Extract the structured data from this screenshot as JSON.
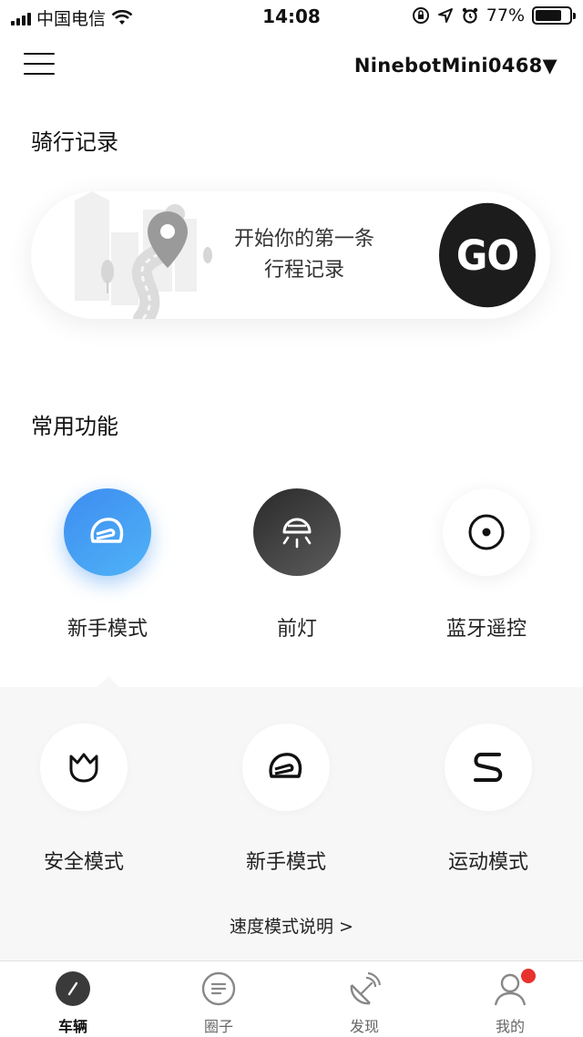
{
  "status_bar": {
    "carrier": "中国电信",
    "time": "14:08",
    "battery_percent": "77%",
    "battery_level": 0.77
  },
  "header": {
    "device_name": "NinebotMini0468▼"
  },
  "ride_record": {
    "title": "骑行记录",
    "prompt_line1": "开始你的第一条",
    "prompt_line2": "行程记录",
    "go_label": "GO"
  },
  "common_functions": {
    "title": "常用功能",
    "items": [
      {
        "label": "新手模式",
        "icon": "helmet-icon",
        "style": "blue"
      },
      {
        "label": "前灯",
        "icon": "headlight-icon",
        "style": "dark"
      },
      {
        "label": "蓝牙遥控",
        "icon": "remote-target-icon",
        "style": "light"
      }
    ]
  },
  "speed_modes": {
    "items": [
      {
        "label": "安全模式",
        "icon": "tulip-icon"
      },
      {
        "label": "新手模式",
        "icon": "helmet-icon"
      },
      {
        "label": "运动模式",
        "icon": "sport-s-icon"
      }
    ],
    "explain_link": "速度模式说明 >"
  },
  "tabbar": {
    "tabs": [
      {
        "label": "车辆",
        "icon": "vehicle-icon",
        "active": true
      },
      {
        "label": "圈子",
        "icon": "circle-chat-icon",
        "active": false
      },
      {
        "label": "发现",
        "icon": "satellite-dish-icon",
        "active": false
      },
      {
        "label": "我的",
        "icon": "user-icon",
        "active": false,
        "badge": true
      }
    ]
  },
  "colors": {
    "accent_blue": "#4a9ef3",
    "go_dark": "#1c1c1c",
    "badge_red": "#e8322d",
    "panel_bg": "#f7f7f7"
  }
}
